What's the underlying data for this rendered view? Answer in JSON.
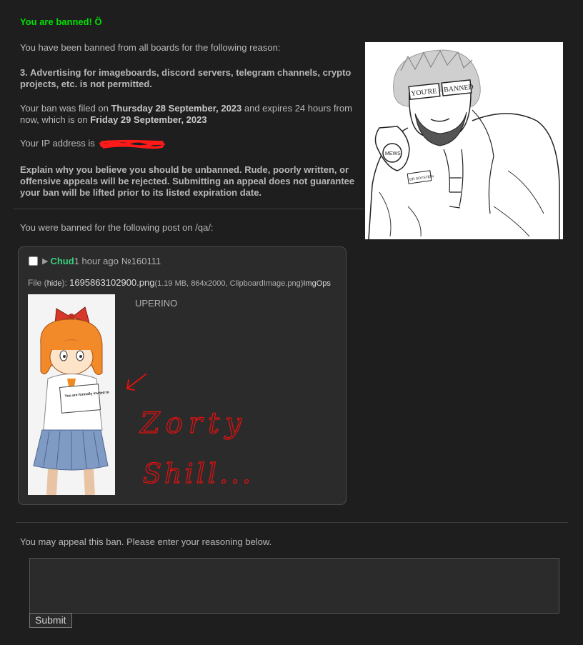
{
  "title": "You are banned! Ö",
  "intro": "You have been banned from all boards for the following reason:",
  "reason": "3. Advertising for imageboards, discord servers, telegram channels, crypto projects, etc. is not permitted.",
  "filed": {
    "pre": "Your ban was filed on ",
    "date": "Thursday 28 September, 2023",
    "mid": " and expires 24 hours from now, which is on ",
    "expires": "Friday 29 September, 2023"
  },
  "ip_label": "Your IP address is",
  "explain": "Explain why you believe you should be unbanned. Rude, poorly written, or offensive appeals will be rejected. Submitting an appeal does not guarantee your ban will be lifted prior to its listed expiration date.",
  "banner_image": {
    "texts": [
      "YOU'RE",
      "BANNED",
      "MEWS",
      "DR SOYSTEIN"
    ]
  },
  "post_intro": "You were banned for the following post on /qa/:",
  "post": {
    "name": "Chud",
    "time": "1 hour ago",
    "number": "№160111",
    "file_label": "File",
    "hide": "hide",
    "filename": "1695863102900.png",
    "meta": "(1.19 MB, 864x2000, ClipboardImage.png)",
    "imgops": "ImgOps",
    "comment": "UPERINO",
    "thumb_text": "You are formally invited to",
    "scrawl": [
      "Zorty",
      "Shill..."
    ]
  },
  "appeal_text": "You may appeal this ban. Please enter your reasoning below.",
  "textarea_value": "",
  "submit_label": "Submit",
  "colors": {
    "title": "#00e000",
    "name": "#39d07a",
    "scrawl": "#e01010",
    "redaction": "#ff1a1a"
  }
}
